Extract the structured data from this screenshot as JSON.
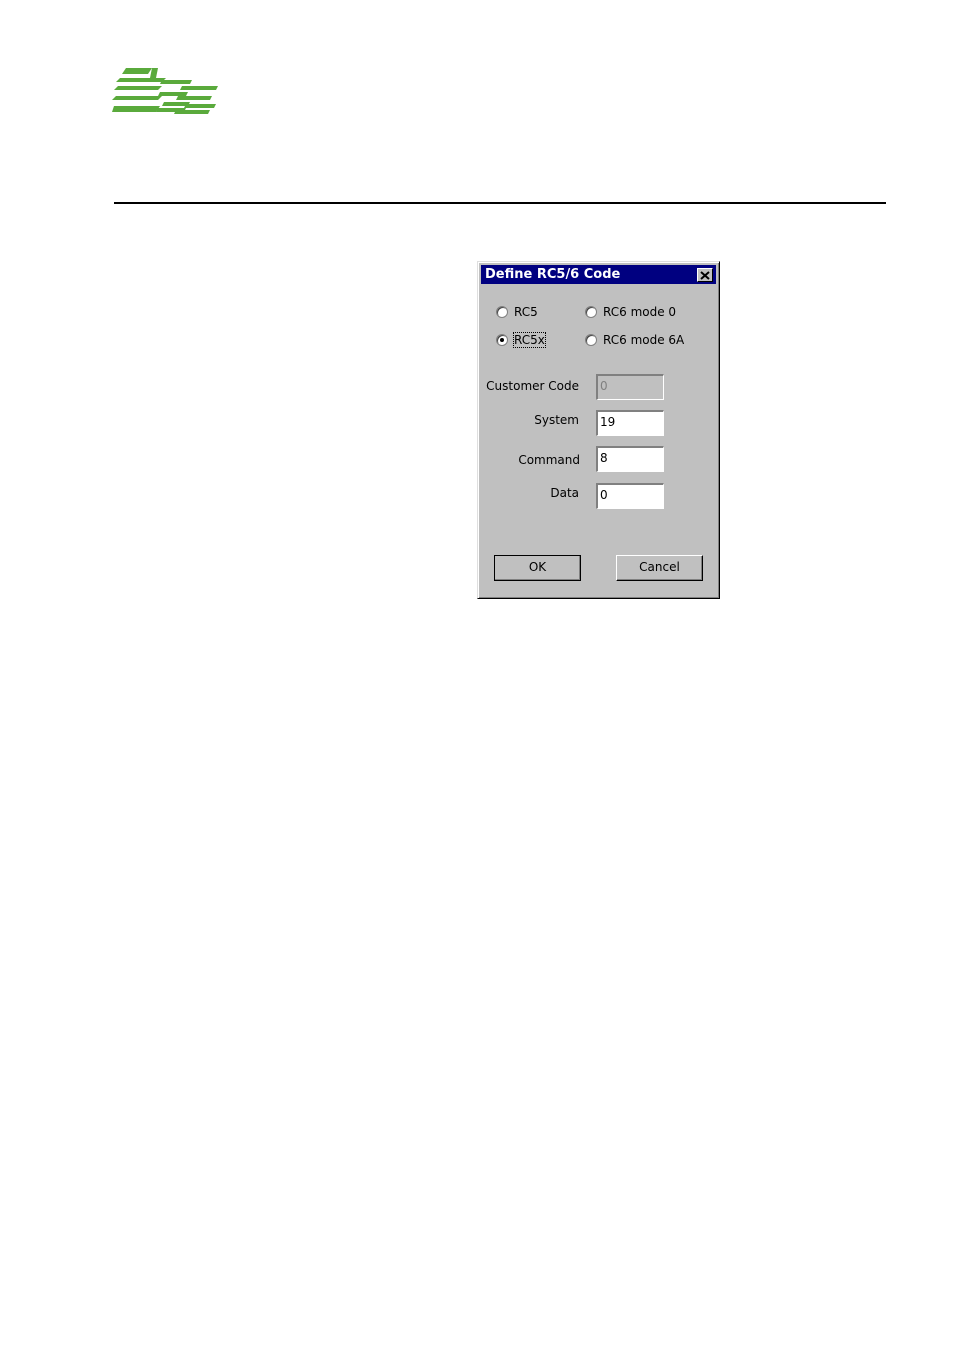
{
  "logo": {
    "name": "BSS",
    "color": "#5aaa3c"
  },
  "dialog": {
    "title": "Define RC5/6 Code",
    "close_icon": "close-icon",
    "radios": [
      {
        "label": "RC5",
        "checked": false
      },
      {
        "label": "RC6 mode 0",
        "checked": false
      },
      {
        "label": "RC5x",
        "checked": true
      },
      {
        "label": "RC6 mode 6A",
        "checked": false
      }
    ],
    "fields": [
      {
        "label": "Customer Code",
        "value": "0",
        "disabled": true
      },
      {
        "label": "System",
        "value": "19",
        "disabled": false
      },
      {
        "label": "Command",
        "value": "8",
        "disabled": false
      },
      {
        "label": "Data",
        "value": "0",
        "disabled": false
      }
    ],
    "ok_label": "OK",
    "cancel_label": "Cancel"
  }
}
